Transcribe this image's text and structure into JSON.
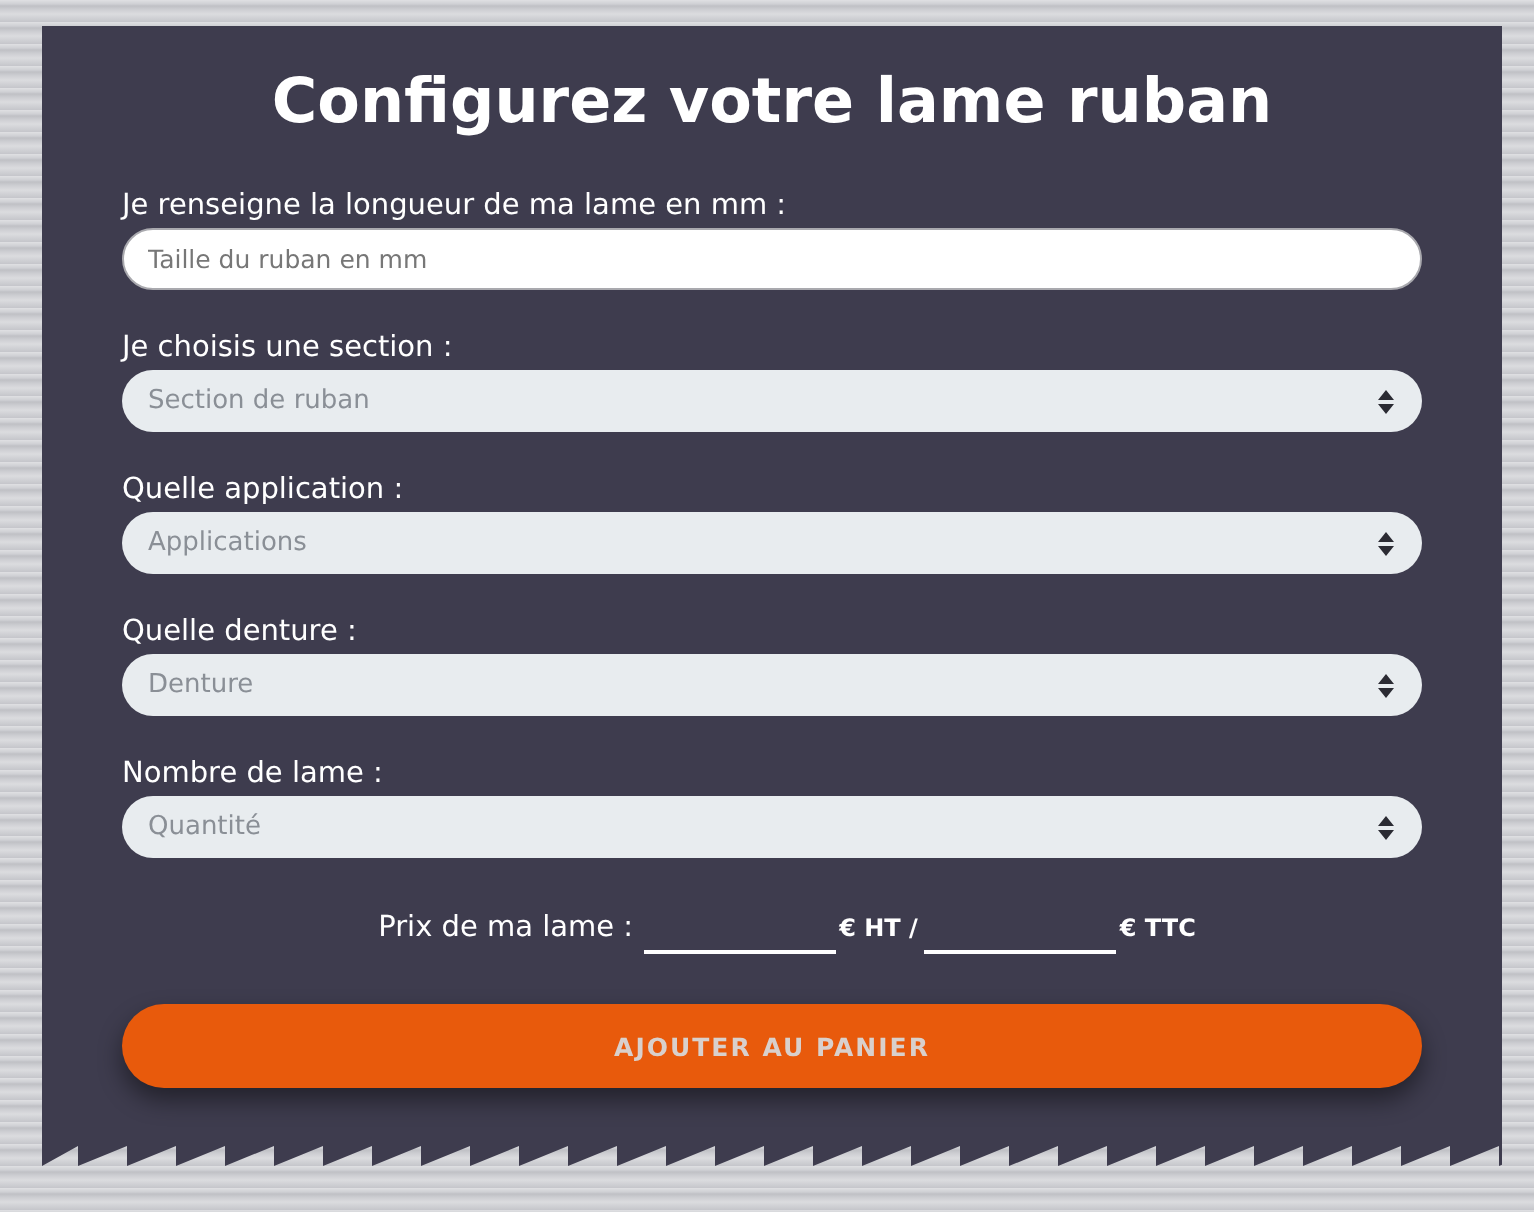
{
  "title": "Configurez votre lame ruban",
  "fields": [
    {
      "kind": "input",
      "label": "Je renseigne la longueur de ma lame en mm :",
      "placeholder": "Taille du ruban en mm"
    },
    {
      "kind": "select",
      "label": "Je choisis une section :",
      "placeholder": "Section de ruban"
    },
    {
      "kind": "select",
      "label": "Quelle application :",
      "placeholder": "Applications"
    },
    {
      "kind": "select",
      "label": "Quelle denture :",
      "placeholder": "Denture"
    },
    {
      "kind": "select",
      "label": "Nombre de lame :",
      "placeholder": "Quantité"
    }
  ],
  "price": {
    "label": "Prix de ma lame :",
    "ht_unit": "€ HT /",
    "ttc_unit": "€ TTC"
  },
  "button": {
    "label": "AJOUTER AU PANIER"
  }
}
